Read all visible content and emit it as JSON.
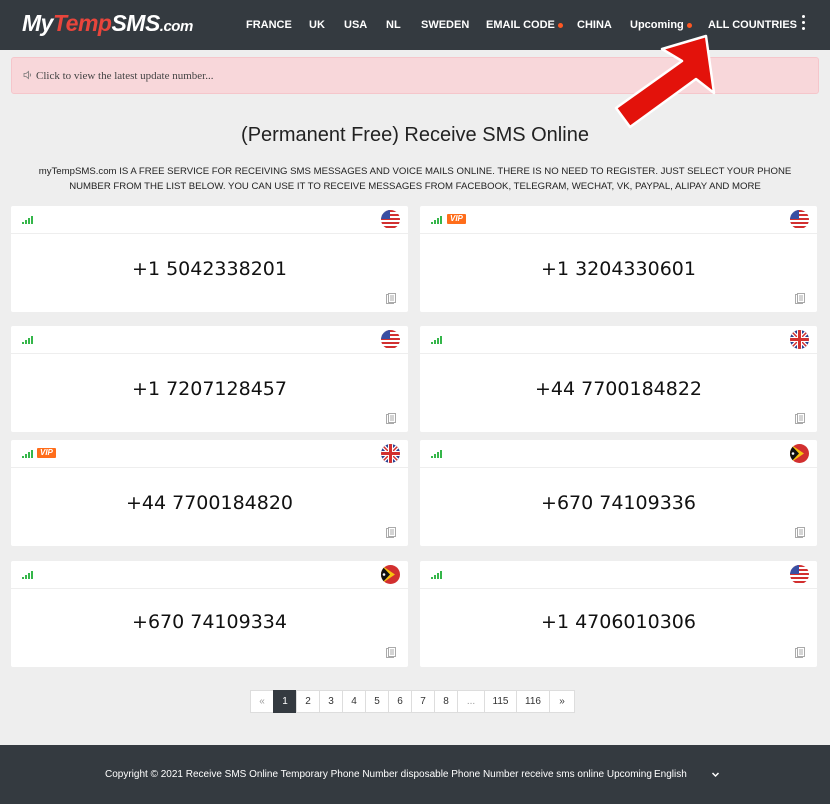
{
  "brand": {
    "part1": "My",
    "part2": "Temp",
    "part3": "SMS",
    "part4": ".com"
  },
  "nav": {
    "items": [
      {
        "label": "FRANCE",
        "dot": false
      },
      {
        "label": "UK",
        "dot": false
      },
      {
        "label": "USA",
        "dot": false
      },
      {
        "label": "NL",
        "dot": false
      },
      {
        "label": "SWEDEN",
        "dot": false
      },
      {
        "label": "EMAIL CODE",
        "dot": true
      },
      {
        "label": "CHINA",
        "dot": false
      },
      {
        "label": "Upcoming",
        "dot": true
      },
      {
        "label": "ALL COUNTRIES",
        "dot": false
      }
    ],
    "dot_color": "#ff5722"
  },
  "announcement": {
    "text": "Click to view the latest update number..."
  },
  "heading": "(Permanent Free) Receive SMS Online",
  "intro": "myTempSMS.com IS A FREE SERVICE FOR RECEIVING SMS MESSAGES AND VOICE MAILS ONLINE. THERE IS NO NEED TO REGISTER. JUST SELECT YOUR PHONE NUMBER FROM THE LIST BELOW. YOU CAN USE IT TO RECEIVE MESSAGES FROM FACEBOOK, TELEGRAM, WECHAT, VK, PAYPAL, ALIPAY AND MORE",
  "vip_label": "VIP",
  "numbers": [
    {
      "number": "+1 5042338201",
      "flag": "us-flag-icon",
      "vip": false
    },
    {
      "number": "+1 3204330601",
      "flag": "us-flag-icon",
      "vip": true
    },
    {
      "number": "+1 7207128457",
      "flag": "us-flag-icon",
      "vip": false
    },
    {
      "number": "+44 7700184822",
      "flag": "uk-flag-icon",
      "vip": false
    },
    {
      "number": "+44 7700184820",
      "flag": "uk-flag-icon",
      "vip": true
    },
    {
      "number": "+670 74109336",
      "flag": "timor-leste-flag-icon",
      "vip": false
    },
    {
      "number": "+670 74109334",
      "flag": "timor-leste-flag-icon",
      "vip": false
    },
    {
      "number": "+1 4706010306",
      "flag": "us-flag-icon",
      "vip": false
    }
  ],
  "pagination": {
    "prev": "«",
    "pages": [
      "1",
      "2",
      "3",
      "4",
      "5",
      "6",
      "7",
      "8",
      "...",
      "115",
      "116"
    ],
    "next": "»",
    "current": "1"
  },
  "footer": {
    "copyright": "Copyright © 2021 Receive SMS Online Temporary Phone Number disposable Phone Number receive sms online Upcoming",
    "language": "English"
  },
  "colors": {
    "navbar": "#343a40",
    "brand_accent": "#e8453c",
    "announcement_bg": "#f8d7da",
    "signal": "#35b64a",
    "vip": "#ff6d1a",
    "arrow": "#e3120b"
  }
}
